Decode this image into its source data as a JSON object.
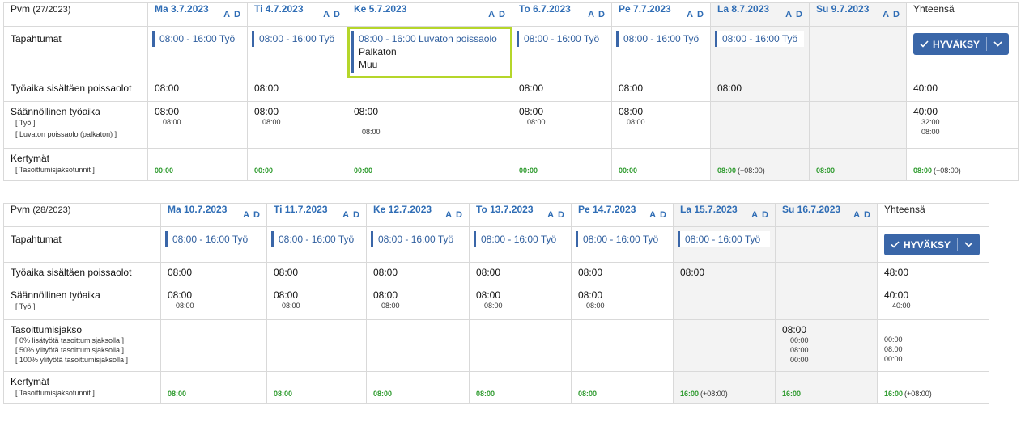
{
  "weeks": [
    {
      "pvm_label": "Pvm",
      "week": "(27/2023)",
      "total_header": "Yhteensä",
      "days": [
        {
          "name": "Ma 3.7.2023",
          "a": "A",
          "d": "D",
          "weekend": false
        },
        {
          "name": "Ti 4.7.2023",
          "a": "A",
          "d": "D",
          "weekend": false
        },
        {
          "name": "Ke 5.7.2023",
          "a": "A",
          "d": "D",
          "weekend": false
        },
        {
          "name": "To 6.7.2023",
          "a": "A",
          "d": "D",
          "weekend": false
        },
        {
          "name": "Pe 7.7.2023",
          "a": "A",
          "d": "D",
          "weekend": false
        },
        {
          "name": "La 8.7.2023",
          "a": "A",
          "d": "D",
          "weekend": true
        },
        {
          "name": "Su 9.7.2023",
          "a": "A",
          "d": "D",
          "weekend": true
        }
      ],
      "tapahtumat_label": "Tapahtumat",
      "events": [
        {
          "text": "08:00 - 16:00 Työ"
        },
        {
          "text": "08:00 - 16:00 Työ"
        },
        {
          "text": "08:00 - 16:00 Luvaton poissaolo",
          "line2": "Palkaton",
          "line3": "Muu",
          "selected": true
        },
        {
          "text": "08:00 - 16:00 Työ"
        },
        {
          "text": "08:00 - 16:00 Työ"
        },
        {
          "text": "08:00 - 16:00 Työ"
        },
        {
          "text": ""
        }
      ],
      "approve_label": "HYVÄKSY",
      "tyoaika_label": "Työaika sisältäen poissaolot",
      "tyoaika": [
        "08:00",
        "08:00",
        "",
        "08:00",
        "08:00",
        "08:00",
        "",
        "40:00"
      ],
      "saannollinen_label": "Säännöllinen työaika",
      "saannollinen_sub": [
        "[ Työ ]",
        "[ Luvaton poissaolo (palkaton) ]"
      ],
      "saannollinen": [
        {
          "main": "08:00",
          "sub1": "08:00",
          "sub2": ""
        },
        {
          "main": "08:00",
          "sub1": "08:00",
          "sub2": ""
        },
        {
          "main": "08:00",
          "sub1": "",
          "sub2": "08:00"
        },
        {
          "main": "08:00",
          "sub1": "08:00",
          "sub2": ""
        },
        {
          "main": "08:00",
          "sub1": "08:00",
          "sub2": ""
        },
        {
          "main": "",
          "sub1": "",
          "sub2": ""
        },
        {
          "main": "",
          "sub1": "",
          "sub2": ""
        },
        {
          "main": "40:00",
          "sub1": "32:00",
          "sub2": "08:00"
        }
      ],
      "kertymat_label": "Kertymät",
      "kertymat_sub": "[ Tasoittumisjaksotunnit ]",
      "kertymat": [
        {
          "v": "00:00",
          "p": ""
        },
        {
          "v": "00:00",
          "p": ""
        },
        {
          "v": "00:00",
          "p": ""
        },
        {
          "v": "00:00",
          "p": ""
        },
        {
          "v": "00:00",
          "p": ""
        },
        {
          "v": "08:00",
          "p": "(+08:00)"
        },
        {
          "v": "08:00",
          "p": ""
        },
        {
          "v": "08:00",
          "p": "(+08:00)"
        }
      ]
    },
    {
      "pvm_label": "Pvm",
      "week": "(28/2023)",
      "total_header": "Yhteensä",
      "days": [
        {
          "name": "Ma 10.7.2023",
          "a": "A",
          "d": "D",
          "weekend": false
        },
        {
          "name": "Ti 11.7.2023",
          "a": "A",
          "d": "D",
          "weekend": false
        },
        {
          "name": "Ke 12.7.2023",
          "a": "A",
          "d": "D",
          "weekend": false
        },
        {
          "name": "To 13.7.2023",
          "a": "A",
          "d": "D",
          "weekend": false
        },
        {
          "name": "Pe 14.7.2023",
          "a": "A",
          "d": "D",
          "weekend": false
        },
        {
          "name": "La 15.7.2023",
          "a": "A",
          "d": "D",
          "weekend": true
        },
        {
          "name": "Su 16.7.2023",
          "a": "A",
          "d": "D",
          "weekend": true
        }
      ],
      "tapahtumat_label": "Tapahtumat",
      "events": [
        {
          "text": "08:00 - 16:00 Työ"
        },
        {
          "text": "08:00 - 16:00 Työ"
        },
        {
          "text": "08:00 - 16:00 Työ"
        },
        {
          "text": "08:00 - 16:00 Työ"
        },
        {
          "text": "08:00 - 16:00 Työ"
        },
        {
          "text": "08:00 - 16:00 Työ"
        },
        {
          "text": ""
        }
      ],
      "approve_label": "HYVÄKSY",
      "tyoaika_label": "Työaika sisältäen poissaolot",
      "tyoaika": [
        "08:00",
        "08:00",
        "08:00",
        "08:00",
        "08:00",
        "08:00",
        "",
        "48:00"
      ],
      "saannollinen_label": "Säännöllinen työaika",
      "saannollinen_sub": [
        "[ Työ ]"
      ],
      "saannollinen": [
        {
          "main": "08:00",
          "sub1": "08:00"
        },
        {
          "main": "08:00",
          "sub1": "08:00"
        },
        {
          "main": "08:00",
          "sub1": "08:00"
        },
        {
          "main": "08:00",
          "sub1": "08:00"
        },
        {
          "main": "08:00",
          "sub1": "08:00"
        },
        {
          "main": "",
          "sub1": ""
        },
        {
          "main": "",
          "sub1": ""
        },
        {
          "main": "40:00",
          "sub1": "40:00"
        }
      ],
      "tasoittumis_label": "Tasoittumisjakso",
      "tasoittumis_sub": [
        "[ 0% lisätyötä tasoittumisjaksolla ]",
        "[ 50% ylityötä tasoittumisjaksolla ]",
        "[ 100% ylityötä tasoittumisjaksolla ]"
      ],
      "tasoittumis_su": {
        "main": "08:00",
        "s1": "00:00",
        "s2": "08:00",
        "s3": "00:00"
      },
      "tasoittumis_total": {
        "s1": "00:00",
        "s2": "08:00",
        "s3": "00:00"
      },
      "kertymat_label": "Kertymät",
      "kertymat_sub": "[ Tasoittumisjaksotunnit ]",
      "kertymat": [
        {
          "v": "08:00",
          "p": ""
        },
        {
          "v": "08:00",
          "p": ""
        },
        {
          "v": "08:00",
          "p": ""
        },
        {
          "v": "08:00",
          "p": ""
        },
        {
          "v": "08:00",
          "p": ""
        },
        {
          "v": "16:00",
          "p": "(+08:00)"
        },
        {
          "v": "16:00",
          "p": ""
        },
        {
          "v": "16:00",
          "p": "(+08:00)"
        }
      ]
    }
  ]
}
